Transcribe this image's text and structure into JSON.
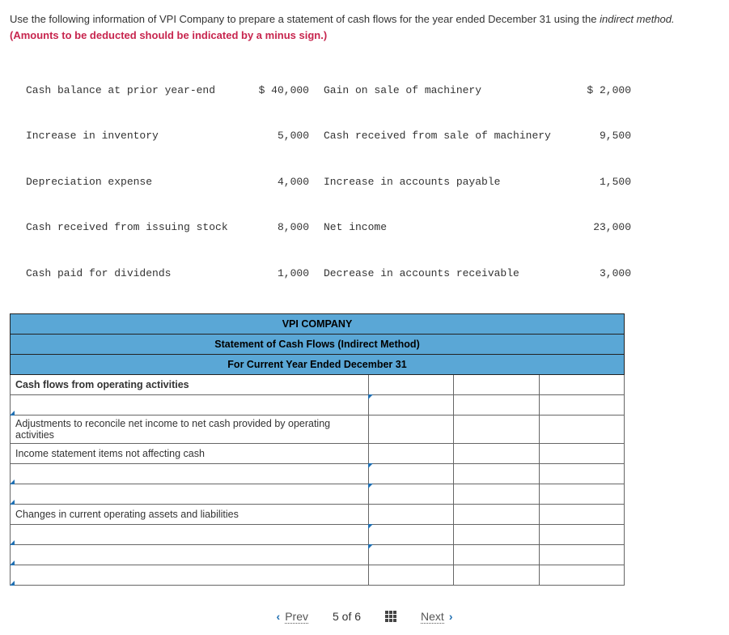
{
  "instructions": {
    "line1a": "Use the following information of VPI Company to prepare a statement of cash flows for the year ended December 31 using the ",
    "line1b": "indirect method. ",
    "line2_red": "(Amounts to be deducted should be indicated by a minus sign.)"
  },
  "info_rows": [
    {
      "l": "Cash balance at prior year-end",
      "la": "$ 40,000",
      "r": "Gain on sale of machinery",
      "ra": "$ 2,000"
    },
    {
      "l": "Increase in inventory",
      "la": "5,000",
      "r": "Cash received from sale of machinery",
      "ra": "9,500"
    },
    {
      "l": "Depreciation expense",
      "la": "4,000",
      "r": "Increase in accounts payable",
      "ra": "1,500"
    },
    {
      "l": "Cash received from issuing stock",
      "la": "8,000",
      "r": "Net income",
      "ra": "23,000"
    },
    {
      "l": "Cash paid for dividends",
      "la": "1,000",
      "r": "Decrease in accounts receivable",
      "ra": "3,000"
    }
  ],
  "statement": {
    "h1": "VPI COMPANY",
    "h2": "Statement of Cash Flows (Indirect Method)",
    "h3": "For Current Year Ended December 31",
    "s_ops": "Cash flows from operating activities",
    "s_adj": "Adjustments to reconcile net income to net cash provided by operating activities",
    "s_inc": "Income statement items not affecting cash",
    "s_chg": "Changes in current operating assets and liabilities"
  },
  "pager": {
    "prev": "Prev",
    "pos": "5 of 6",
    "next": "Next"
  }
}
